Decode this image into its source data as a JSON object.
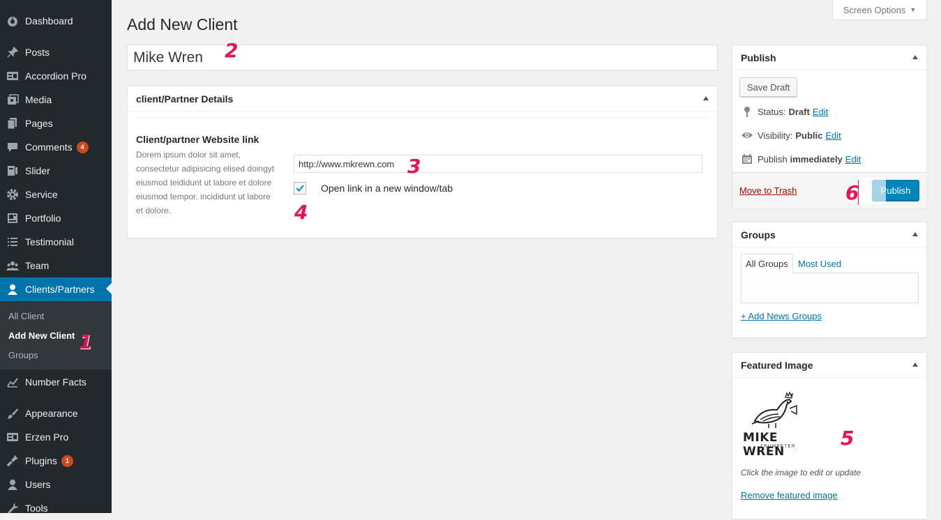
{
  "sidebar": {
    "items": [
      {
        "label": "Dashboard",
        "icon": "dashboard-icon"
      },
      {
        "label": "Posts",
        "icon": "pin-icon"
      },
      {
        "label": "Accordion Pro",
        "icon": "list-icon"
      },
      {
        "label": "Media",
        "icon": "media-icon"
      },
      {
        "label": "Pages",
        "icon": "pages-icon"
      },
      {
        "label": "Comments",
        "icon": "comment-icon",
        "badge": "4"
      },
      {
        "label": "Slider",
        "icon": "slider-icon"
      },
      {
        "label": "Service",
        "icon": "gear-icon"
      },
      {
        "label": "Portfolio",
        "icon": "portfolio-icon"
      },
      {
        "label": "Testimonial",
        "icon": "list-icon"
      },
      {
        "label": "Team",
        "icon": "groups-icon"
      },
      {
        "label": "Clients/Partners",
        "icon": "user-icon",
        "current": true
      },
      {
        "label": "Number Facts",
        "icon": "chart-icon"
      },
      {
        "label": "Appearance",
        "icon": "brush-icon"
      },
      {
        "label": "Erzen Pro",
        "icon": "list-icon"
      },
      {
        "label": "Plugins",
        "icon": "plug-icon",
        "badge": "1"
      },
      {
        "label": "Users",
        "icon": "user-icon"
      },
      {
        "label": "Tools",
        "icon": "wrench-icon"
      }
    ],
    "submenu": [
      "All Client",
      "Add New Client",
      "Groups"
    ]
  },
  "screen_options": "Screen Options",
  "page_title": "Add New Client",
  "title_value": "Mike Wren",
  "details": {
    "box_title": "client/Partner Details",
    "field_label": "Client/partner Website link",
    "description": "Dorem ipsum dolor sit amet, consectetur adipisicing elised doingyt eiusmod teididunt ut labore et dolore eiusmod tempor. incididunt ut labore et dolore.",
    "url_value": "http://www.mkrewn.com",
    "newtab_label": "Open link in a new window/tab",
    "newtab_checked": true
  },
  "publish": {
    "title": "Publish",
    "save_draft": "Save Draft",
    "status_label": "Status:",
    "status_value": "Draft",
    "visibility_label": "Visibility:",
    "visibility_value": "Public",
    "publish_label": "Publish",
    "publish_value": "immediately",
    "edit": "Edit",
    "trash": "Move to Trash",
    "publish_button": "Publish"
  },
  "groups": {
    "title": "Groups",
    "tab_all": "All Groups",
    "tab_most": "Most Used",
    "add_link": "+ Add News Groups"
  },
  "featured": {
    "title": "Featured Image",
    "logo_name": "MIKE WREN",
    "logo_sub": "TRUMPETER",
    "hint": "Click the image to edit or update",
    "remove": "Remove featured image"
  },
  "annotations": [
    "1",
    "2",
    "3",
    "4",
    "5",
    "6"
  ],
  "colors": {
    "sidebar_bg": "#23282d",
    "active_bg": "#0073aa",
    "link": "#0073aa",
    "annotation": "#e4145a",
    "badge": "#ca4a1f",
    "publish_button": "#0085ba"
  }
}
